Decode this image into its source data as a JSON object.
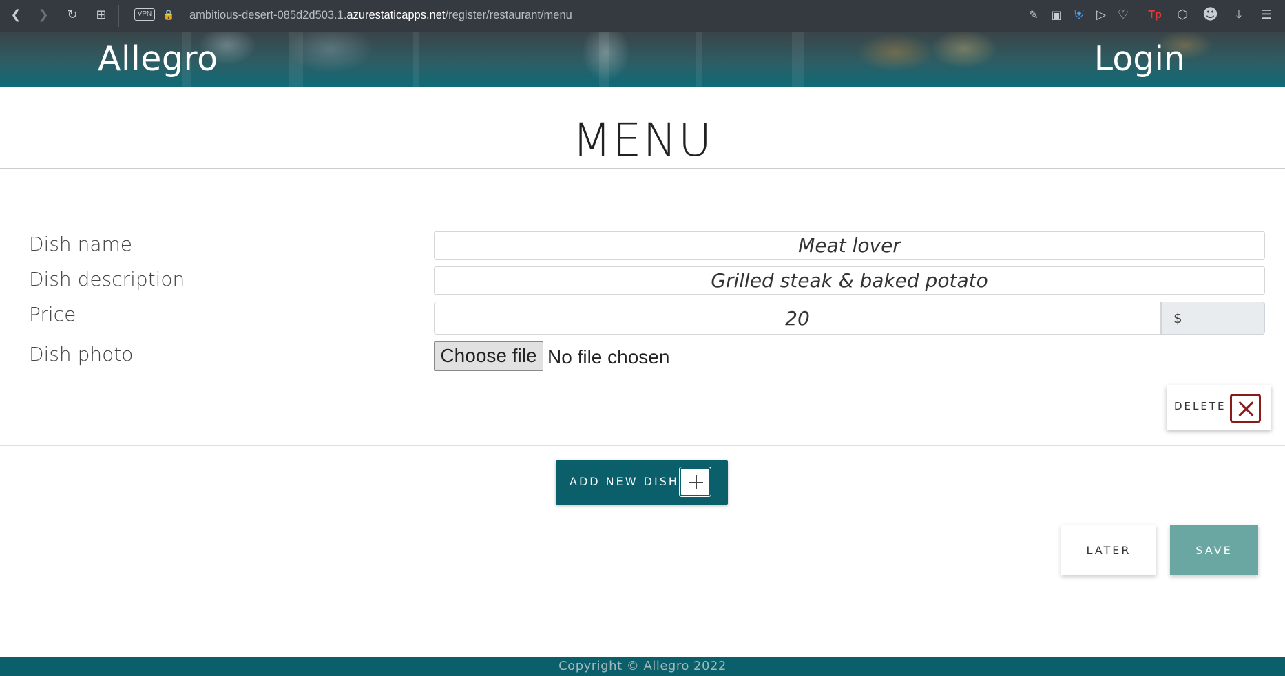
{
  "browser": {
    "url_prefix": "ambitious-desert-085d2d503.1.",
    "url_domain": "azurestaticapps.net",
    "url_path": "/register/restaurant/menu",
    "vpn_label": "VPN",
    "profile_badge": "Tp"
  },
  "header": {
    "brand": "Allegro",
    "login": "Login"
  },
  "page": {
    "title": "MENU"
  },
  "form": {
    "dish_name_label": "Dish name",
    "dish_name_value": "Meat lover",
    "dish_description_label": "Dish description",
    "dish_description_value": "Grilled steak & baked potato",
    "price_label": "Price",
    "price_value": "20",
    "currency": "$",
    "photo_label": "Dish photo",
    "choose_file": "Choose file",
    "no_file": "No file chosen"
  },
  "actions": {
    "delete": "DELETE",
    "add_new_dish": "ADD NEW DISH",
    "later": "LATER",
    "save": "SAVE"
  },
  "footer": {
    "copyright": "Copyright © Allegro 2022"
  },
  "colors": {
    "brand_teal": "#0b5f6b",
    "save_teal": "#6aa6a2",
    "delete_red": "#8a1b1b"
  }
}
